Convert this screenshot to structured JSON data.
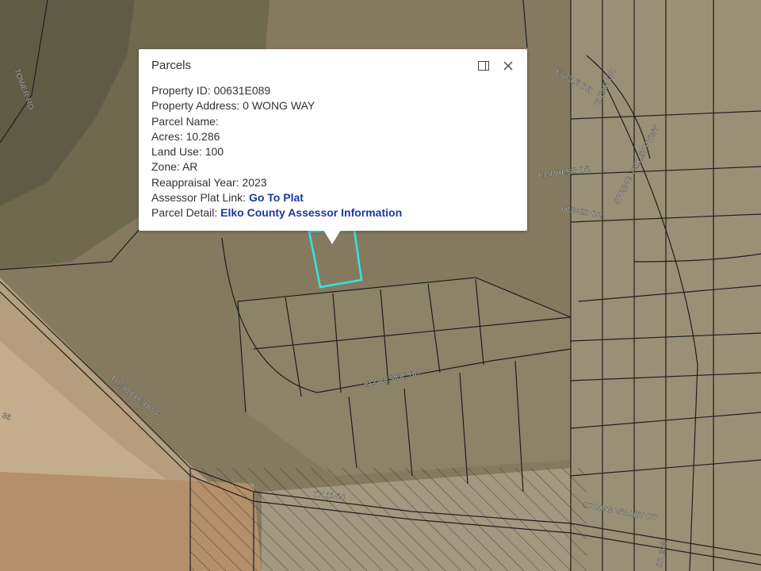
{
  "popup": {
    "title": "Parcels",
    "dock_icon": "dock-panel-icon",
    "close_icon": "close-icon",
    "fields": [
      {
        "label": "Property ID:",
        "value": "00631E089"
      },
      {
        "label": "Property Address:",
        "value": "0 WONG WAY"
      },
      {
        "label": "Parcel Name:",
        "value": ""
      },
      {
        "label": "Acres:",
        "value": "10.286"
      },
      {
        "label": "Land Use:",
        "value": "100"
      },
      {
        "label": "Zone:",
        "value": "AR"
      },
      {
        "label": "Reappraisal Year:",
        "value": "2023"
      }
    ],
    "plat_link": {
      "label": "Assessor Plat Link:",
      "text": "Go To Plat"
    },
    "detail_link": {
      "label": "Parcel Detail:",
      "text": "Elko County Assessor Information"
    }
  },
  "map": {
    "selection_color": "#2ee6e6",
    "road_labels": [
      {
        "name": "TOWER RD"
      },
      {
        "name": "ENGLE DR"
      },
      {
        "name": "CLEAR DR"
      },
      {
        "name": "EMPRESS DR"
      },
      {
        "name": "SPRING VALLEY PKWY"
      },
      {
        "name": "DUNES DR"
      },
      {
        "name": "LAMOILLE HWY"
      },
      {
        "name": "BLUFFSIDE DR"
      },
      {
        "name": "TH 11-10"
      },
      {
        "name": "SPRING VALLEY CT"
      },
      {
        "name": "SR 228"
      },
      {
        "name": "36"
      }
    ]
  }
}
